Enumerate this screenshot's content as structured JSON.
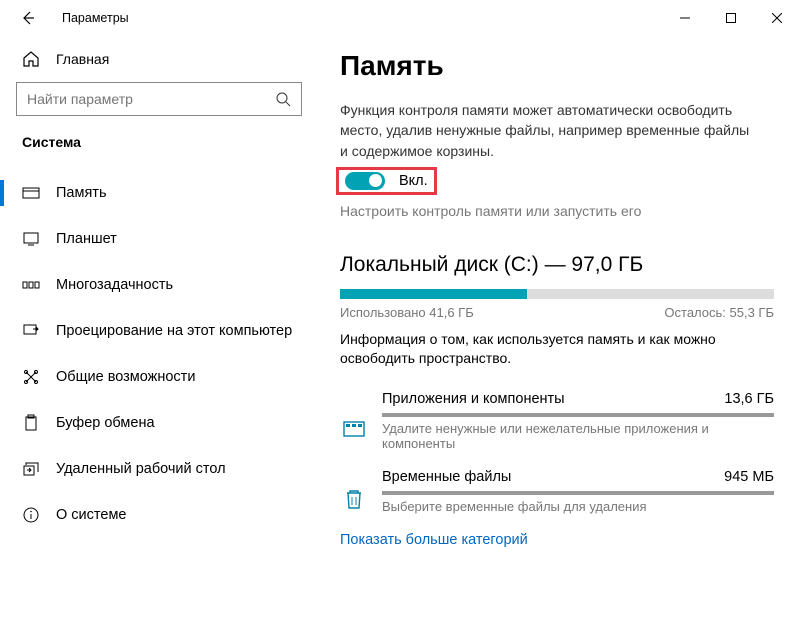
{
  "window": {
    "title": "Параметры"
  },
  "sidebar": {
    "home": "Главная",
    "search_placeholder": "Найти параметр",
    "section": "Система",
    "items": [
      {
        "label": "Память"
      },
      {
        "label": "Планшет"
      },
      {
        "label": "Многозадачность"
      },
      {
        "label": "Проецирование на этот компьютер"
      },
      {
        "label": "Общие возможности"
      },
      {
        "label": "Буфер обмена"
      },
      {
        "label": "Удаленный рабочий стол"
      },
      {
        "label": "О системе"
      }
    ]
  },
  "main": {
    "title": "Память",
    "storage_sense_desc": "Функция контроля памяти может автоматически освободить место, удалив ненужные файлы, например временные файлы и содержимое корзины.",
    "toggle_label": "Вкл.",
    "configure_link": "Настроить контроль памяти или запустить его",
    "disk": {
      "title": "Локальный диск (C:) — 97,0 ГБ",
      "used_label": "Использовано 41,6 ГБ",
      "free_label": "Осталось: 55,3 ГБ"
    },
    "usage_info": "Информация о том, как используется память и как можно освободить пространство.",
    "categories": [
      {
        "name": "Приложения и компоненты",
        "size": "13,6 ГБ",
        "hint": "Удалите ненужные или нежелательные приложения и компоненты"
      },
      {
        "name": "Временные файлы",
        "size": "945 МБ",
        "hint": "Выберите временные файлы для удаления"
      }
    ],
    "show_more": "Показать больше категорий"
  }
}
